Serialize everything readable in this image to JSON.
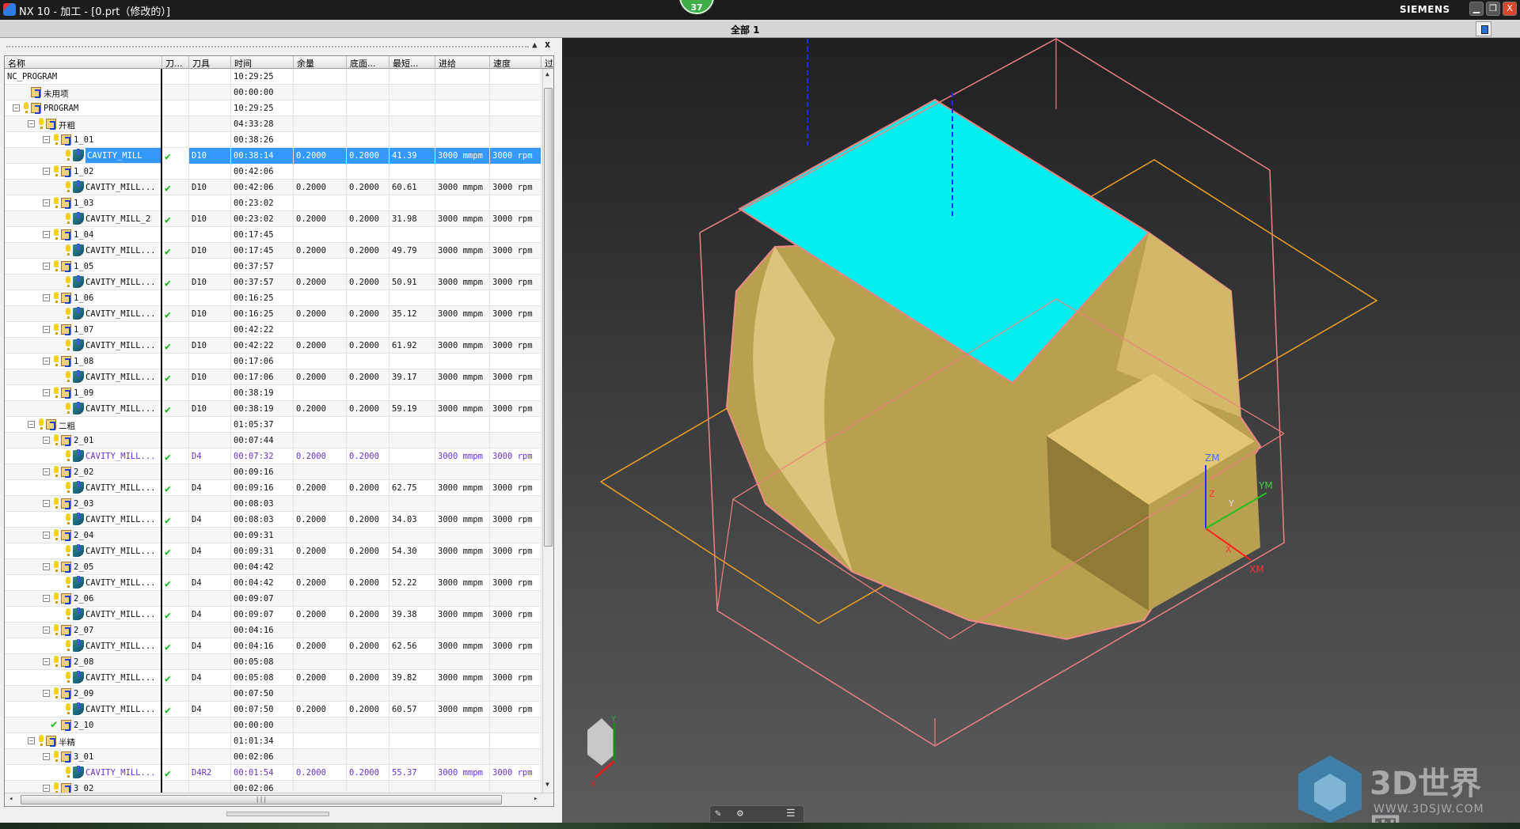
{
  "window": {
    "title": "NX 10 - 加工 - [0.prt（修改的）]",
    "brand": "SIEMENS",
    "notification_count": "37",
    "controls": {
      "minimize": "▁",
      "restore": "❐",
      "close": "X"
    }
  },
  "toolbar": {
    "filter_label": "全部 1"
  },
  "navigator": {
    "close_label": "x",
    "columns": [
      "名称",
      "刀...",
      "刀具",
      "时间",
      "余量",
      "底面...",
      "最短...",
      "进给",
      "速度",
      "过"
    ],
    "rows": [
      {
        "level": 0,
        "type": "root",
        "name": "NC_PROGRAM",
        "time": "10:29:25"
      },
      {
        "level": 1,
        "type": "folder",
        "name": "未用项",
        "time": "00:00:00",
        "noexp": true,
        "nobulb": true
      },
      {
        "level": 1,
        "type": "folder",
        "name": "PROGRAM",
        "time": "10:29:25"
      },
      {
        "level": 2,
        "type": "folder",
        "name": "开粗",
        "time": "04:33:28"
      },
      {
        "level": 3,
        "type": "folder",
        "name": "1_01",
        "time": "00:38:26"
      },
      {
        "level": 4,
        "type": "op",
        "name": "CAVITY_MILL",
        "tool": "D10",
        "time": "00:38:14",
        "stock": "0.2000",
        "floor": "0.2000",
        "shortest": "41.39",
        "feed": "3000 mmpm",
        "speed": "3000 rpm",
        "selected": true
      },
      {
        "level": 3,
        "type": "folder",
        "name": "1_02",
        "time": "00:42:06"
      },
      {
        "level": 4,
        "type": "op",
        "name": "CAVITY_MILL...",
        "tool": "D10",
        "time": "00:42:06",
        "stock": "0.2000",
        "floor": "0.2000",
        "shortest": "60.61",
        "feed": "3000 mmpm",
        "speed": "3000 rpm"
      },
      {
        "level": 3,
        "type": "folder",
        "name": "1_03",
        "time": "00:23:02"
      },
      {
        "level": 4,
        "type": "op",
        "name": "CAVITY_MILL_2",
        "tool": "D10",
        "time": "00:23:02",
        "stock": "0.2000",
        "floor": "0.2000",
        "shortest": "31.98",
        "feed": "3000 mmpm",
        "speed": "3000 rpm"
      },
      {
        "level": 3,
        "type": "folder",
        "name": "1_04",
        "time": "00:17:45"
      },
      {
        "level": 4,
        "type": "op",
        "name": "CAVITY_MILL...",
        "tool": "D10",
        "time": "00:17:45",
        "stock": "0.2000",
        "floor": "0.2000",
        "shortest": "49.79",
        "feed": "3000 mmpm",
        "speed": "3000 rpm"
      },
      {
        "level": 3,
        "type": "folder",
        "name": "1_05",
        "time": "00:37:57"
      },
      {
        "level": 4,
        "type": "op",
        "name": "CAVITY_MILL...",
        "tool": "D10",
        "time": "00:37:57",
        "stock": "0.2000",
        "floor": "0.2000",
        "shortest": "50.91",
        "feed": "3000 mmpm",
        "speed": "3000 rpm"
      },
      {
        "level": 3,
        "type": "folder",
        "name": "1_06",
        "time": "00:16:25"
      },
      {
        "level": 4,
        "type": "op",
        "name": "CAVITY_MILL...",
        "tool": "D10",
        "time": "00:16:25",
        "stock": "0.2000",
        "floor": "0.2000",
        "shortest": "35.12",
        "feed": "3000 mmpm",
        "speed": "3000 rpm"
      },
      {
        "level": 3,
        "type": "folder",
        "name": "1_07",
        "time": "00:42:22"
      },
      {
        "level": 4,
        "type": "op",
        "name": "CAVITY_MILL...",
        "tool": "D10",
        "time": "00:42:22",
        "stock": "0.2000",
        "floor": "0.2000",
        "shortest": "61.92",
        "feed": "3000 mmpm",
        "speed": "3000 rpm"
      },
      {
        "level": 3,
        "type": "folder",
        "name": "1_08",
        "time": "00:17:06"
      },
      {
        "level": 4,
        "type": "op",
        "name": "CAVITY_MILL...",
        "tool": "D10",
        "time": "00:17:06",
        "stock": "0.2000",
        "floor": "0.2000",
        "shortest": "39.17",
        "feed": "3000 mmpm",
        "speed": "3000 rpm"
      },
      {
        "level": 3,
        "type": "folder",
        "name": "1_09",
        "time": "00:38:19"
      },
      {
        "level": 4,
        "type": "op",
        "name": "CAVITY_MILL...",
        "tool": "D10",
        "time": "00:38:19",
        "stock": "0.2000",
        "floor": "0.2000",
        "shortest": "59.19",
        "feed": "3000 mmpm",
        "speed": "3000 rpm"
      },
      {
        "level": 2,
        "type": "folder",
        "name": "二粗",
        "time": "01:05:37"
      },
      {
        "level": 3,
        "type": "folder",
        "name": "2_01",
        "time": "00:07:44"
      },
      {
        "level": 4,
        "type": "op",
        "name": "CAVITY_MILL...",
        "tool": "D4",
        "time": "00:07:32",
        "stock": "0.2000",
        "floor": "0.2000",
        "shortest": "",
        "feed": "3000 mmpm",
        "speed": "3000 rpm",
        "modified": true
      },
      {
        "level": 3,
        "type": "folder",
        "name": "2_02",
        "time": "00:09:16"
      },
      {
        "level": 4,
        "type": "op",
        "name": "CAVITY_MILL...",
        "tool": "D4",
        "time": "00:09:16",
        "stock": "0.2000",
        "floor": "0.2000",
        "shortest": "62.75",
        "feed": "3000 mmpm",
        "speed": "3000 rpm"
      },
      {
        "level": 3,
        "type": "folder",
        "name": "2_03",
        "time": "00:08:03"
      },
      {
        "level": 4,
        "type": "op",
        "name": "CAVITY_MILL...",
        "tool": "D4",
        "time": "00:08:03",
        "stock": "0.2000",
        "floor": "0.2000",
        "shortest": "34.03",
        "feed": "3000 mmpm",
        "speed": "3000 rpm"
      },
      {
        "level": 3,
        "type": "folder",
        "name": "2_04",
        "time": "00:09:31"
      },
      {
        "level": 4,
        "type": "op",
        "name": "CAVITY_MILL...",
        "tool": "D4",
        "time": "00:09:31",
        "stock": "0.2000",
        "floor": "0.2000",
        "shortest": "54.30",
        "feed": "3000 mmpm",
        "speed": "3000 rpm"
      },
      {
        "level": 3,
        "type": "folder",
        "name": "2_05",
        "time": "00:04:42"
      },
      {
        "level": 4,
        "type": "op",
        "name": "CAVITY_MILL...",
        "tool": "D4",
        "time": "00:04:42",
        "stock": "0.2000",
        "floor": "0.2000",
        "shortest": "52.22",
        "feed": "3000 mmpm",
        "speed": "3000 rpm"
      },
      {
        "level": 3,
        "type": "folder",
        "name": "2_06",
        "time": "00:09:07"
      },
      {
        "level": 4,
        "type": "op",
        "name": "CAVITY_MILL...",
        "tool": "D4",
        "time": "00:09:07",
        "stock": "0.2000",
        "floor": "0.2000",
        "shortest": "39.38",
        "feed": "3000 mmpm",
        "speed": "3000 rpm"
      },
      {
        "level": 3,
        "type": "folder",
        "name": "2_07",
        "time": "00:04:16"
      },
      {
        "level": 4,
        "type": "op",
        "name": "CAVITY_MILL...",
        "tool": "D4",
        "time": "00:04:16",
        "stock": "0.2000",
        "floor": "0.2000",
        "shortest": "62.56",
        "feed": "3000 mmpm",
        "speed": "3000 rpm"
      },
      {
        "level": 3,
        "type": "folder",
        "name": "2_08",
        "time": "00:05:08"
      },
      {
        "level": 4,
        "type": "op",
        "name": "CAVITY_MILL...",
        "tool": "D4",
        "time": "00:05:08",
        "stock": "0.2000",
        "floor": "0.2000",
        "shortest": "39.82",
        "feed": "3000 mmpm",
        "speed": "3000 rpm"
      },
      {
        "level": 3,
        "type": "folder",
        "name": "2_09",
        "time": "00:07:50"
      },
      {
        "level": 4,
        "type": "op",
        "name": "CAVITY_MILL...",
        "tool": "D4",
        "time": "00:07:50",
        "stock": "0.2000",
        "floor": "0.2000",
        "shortest": "60.57",
        "feed": "3000 mmpm",
        "speed": "3000 rpm"
      },
      {
        "level": 3,
        "type": "folder",
        "name": "2_10",
        "time": "00:00:00",
        "noexp": true,
        "checked": true
      },
      {
        "level": 2,
        "type": "folder",
        "name": "半精",
        "time": "01:01:34"
      },
      {
        "level": 3,
        "type": "folder",
        "name": "3_01",
        "time": "00:02:06"
      },
      {
        "level": 4,
        "type": "op",
        "name": "CAVITY_MILL...",
        "tool": "D4R2",
        "time": "00:01:54",
        "stock": "0.2000",
        "floor": "0.2000",
        "shortest": "55.37",
        "feed": "3000 mmpm",
        "speed": "3000 rpm",
        "modified": true
      },
      {
        "level": 3,
        "type": "folder",
        "name": "3_02",
        "time": "00:02:06"
      }
    ]
  },
  "viewport": {
    "colors": {
      "top_face": "#00f0f0",
      "part": "#d9bf6a",
      "wireframe": "#f08080",
      "plane": "#f0a020"
    },
    "csys_labels": {
      "zm": "ZM",
      "ym": "YM",
      "xm": "XM",
      "z": "Z",
      "y": "Y",
      "x": "X"
    },
    "triad_labels": {
      "y": "Y",
      "x": "X"
    },
    "watermark": {
      "text": "3D世界网",
      "url": "WWW.3DSJW.COM"
    }
  }
}
